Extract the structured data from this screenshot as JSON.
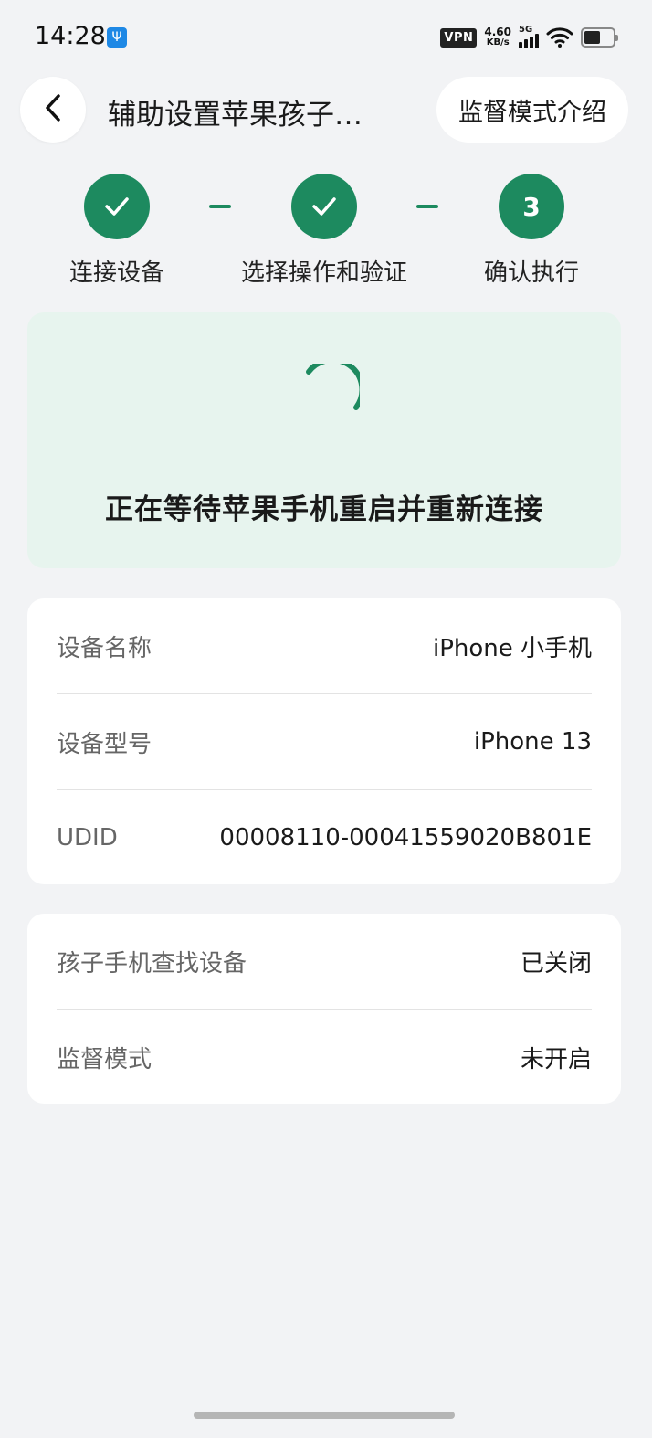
{
  "status_bar": {
    "time": "14:28",
    "usb_icon": "usb-icon",
    "vpn": "VPN",
    "speed_value": "4.60",
    "speed_unit": "KB/s",
    "network": "5G",
    "battery_level": 0.55
  },
  "header": {
    "title": "辅助设置苹果孩子…",
    "intro_button": "监督模式介绍"
  },
  "steps": [
    {
      "label": "连接设备",
      "state": "done"
    },
    {
      "label": "选择操作和验证",
      "state": "done"
    },
    {
      "label": "确认执行",
      "state": "current",
      "number": "3"
    }
  ],
  "waiting": {
    "message": "正在等待苹果手机重启并重新连接"
  },
  "device_info": [
    {
      "key": "设备名称",
      "value": "iPhone 小手机"
    },
    {
      "key": "设备型号",
      "value": "iPhone 13"
    },
    {
      "key": "UDID",
      "value": "00008110-00041559020B801E"
    }
  ],
  "status_info": [
    {
      "key": "孩子手机查找设备",
      "value": "已关闭"
    },
    {
      "key": "监督模式",
      "value": "未开启"
    }
  ],
  "colors": {
    "accent": "#1d8a5f",
    "wait_bg": "#e7f4ee",
    "page_bg": "#f2f3f5"
  }
}
